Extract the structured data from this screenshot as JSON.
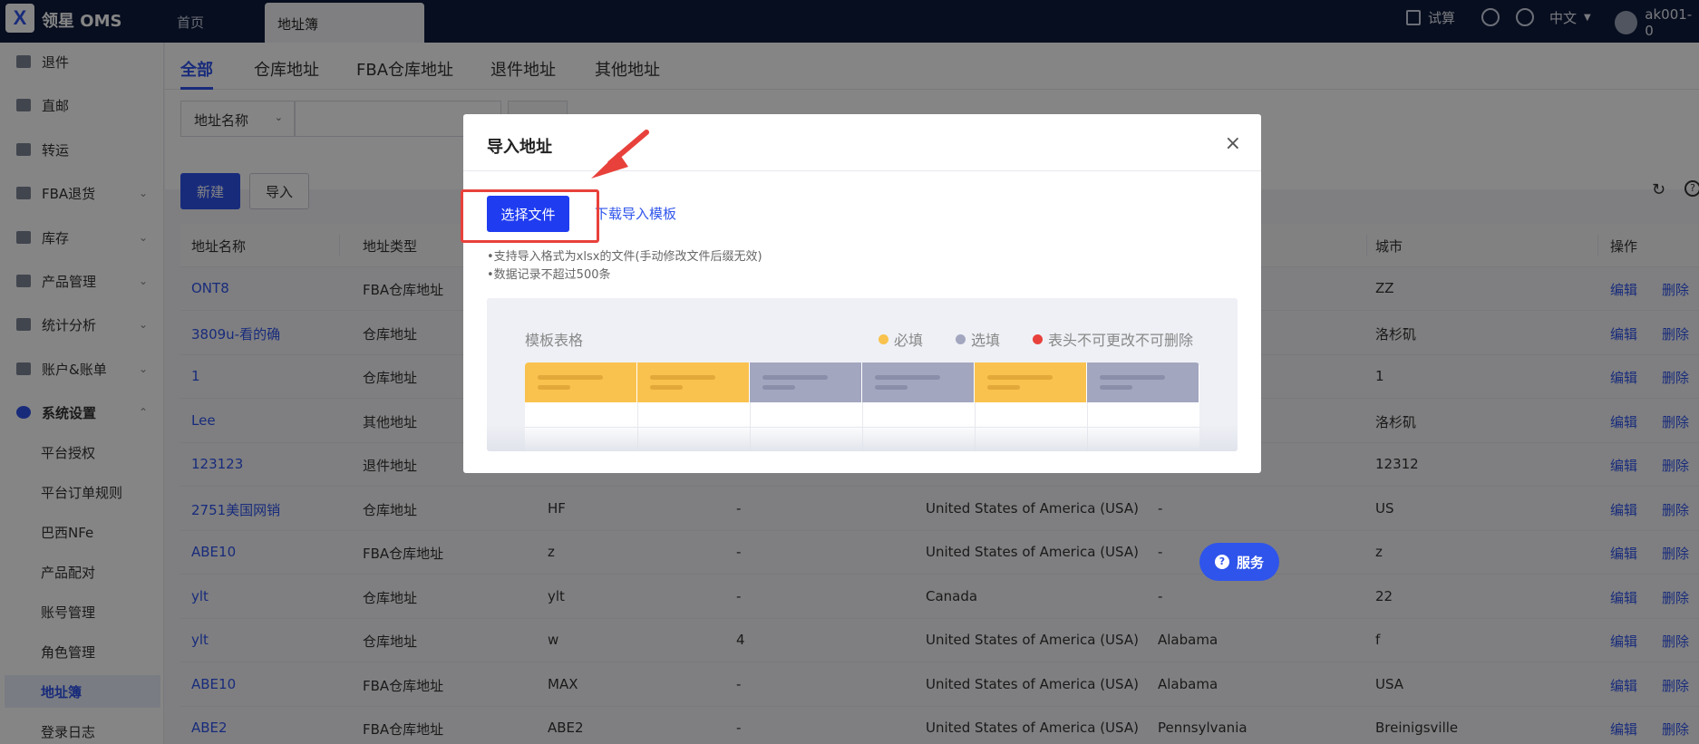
{
  "app": {
    "logo": "X",
    "name": "领星 OMS"
  },
  "top_tabs": {
    "home": "首页",
    "address_book": "地址簿"
  },
  "topbar_right": {
    "trial": "试算",
    "lang": "中文",
    "user": "ak001-0"
  },
  "sidebar": {
    "items": [
      {
        "label": "退件",
        "icon": "return-icon"
      },
      {
        "label": "直邮",
        "icon": "mail-icon"
      },
      {
        "label": "转运",
        "icon": "transfer-icon"
      },
      {
        "label": "FBA退货",
        "icon": "fba-return-icon"
      },
      {
        "label": "库存",
        "icon": "inventory-icon"
      },
      {
        "label": "产品管理",
        "icon": "product-icon"
      },
      {
        "label": "统计分析",
        "icon": "stats-icon"
      },
      {
        "label": "账户&账单",
        "icon": "account-icon"
      },
      {
        "label": "系统设置",
        "icon": "settings-icon"
      }
    ],
    "sub_items": [
      "平台授权",
      "平台订单规则",
      "巴西NFe",
      "产品配对",
      "账号管理",
      "角色管理",
      "地址簿",
      "登录日志"
    ]
  },
  "subtabs": [
    "全部",
    "仓库地址",
    "FBA仓库地址",
    "退件地址",
    "其他地址"
  ],
  "filter": {
    "select_label": "地址名称"
  },
  "toolbar": {
    "new_label": "新建",
    "import_label": "导入",
    "refresh": "↻",
    "help": "?"
  },
  "table": {
    "headers": [
      "地址名称",
      "地址类型",
      "城市",
      "操作"
    ],
    "rows": [
      {
        "name": "ONT8",
        "type": "FBA仓库地址",
        "c3": "",
        "c4": "",
        "country": "",
        "state": "",
        "city": "ZZ"
      },
      {
        "name": "3809u-看的确",
        "type": "仓库地址",
        "c3": "",
        "c4": "",
        "country": "",
        "state": "",
        "city": "洛杉矶"
      },
      {
        "name": "1",
        "type": "仓库地址",
        "c3": "",
        "c4": "",
        "country": "",
        "state": "",
        "city": "1"
      },
      {
        "name": "Lee",
        "type": "其他地址",
        "c3": "",
        "c4": "",
        "country": "",
        "state": "",
        "city": "洛杉矶"
      },
      {
        "name": "123123",
        "type": "退件地址",
        "c3": "",
        "c4": "",
        "country": "",
        "state": "",
        "city": "12312"
      },
      {
        "name": "2751美国网销",
        "type": "仓库地址",
        "c3": "HF",
        "c4": "-",
        "country": "United States of America (USA)",
        "state": "-",
        "city": "US"
      },
      {
        "name": "ABE10",
        "type": "FBA仓库地址",
        "c3": "z",
        "c4": "-",
        "country": "United States of America (USA)",
        "state": "-",
        "city": "z"
      },
      {
        "name": "ylt",
        "type": "仓库地址",
        "c3": "ylt",
        "c4": "-",
        "country": "Canada",
        "state": "-",
        "city": "22"
      },
      {
        "name": "ylt",
        "type": "仓库地址",
        "c3": "w",
        "c4": "4",
        "country": "United States of America (USA)",
        "state": "Alabama",
        "city": "f"
      },
      {
        "name": "ABE10",
        "type": "FBA仓库地址",
        "c3": "MAX",
        "c4": "-",
        "country": "United States of America (USA)",
        "state": "Alabama",
        "city": "USA"
      },
      {
        "name": "ABE2",
        "type": "FBA仓库地址",
        "c3": "ABE2",
        "c4": "-",
        "country": "United States of America (USA)",
        "state": "Pennsylvania",
        "city": "Breinigsville"
      }
    ],
    "edit_label": "编辑",
    "delete_label": "删除"
  },
  "modal": {
    "title": "导入地址",
    "close": "×",
    "choose_file": "选择文件",
    "download_template": "下载导入模板",
    "notes": [
      "•支持导入格式为xlsx的文件(手动修改文件后缀无效)",
      "•数据记录不超过500条"
    ],
    "template_title": "模板表格",
    "legend": [
      {
        "label": "必填",
        "color": "#f9c24e"
      },
      {
        "label": "选填",
        "color": "#a3a6bf"
      },
      {
        "label": "表头不可更改不可删除",
        "color": "#e8413b"
      }
    ]
  },
  "service": {
    "label": "服务"
  },
  "colors": {
    "accent": "#2f54eb",
    "topbar": "#0f1b3d",
    "highlight": "#e8413b"
  }
}
